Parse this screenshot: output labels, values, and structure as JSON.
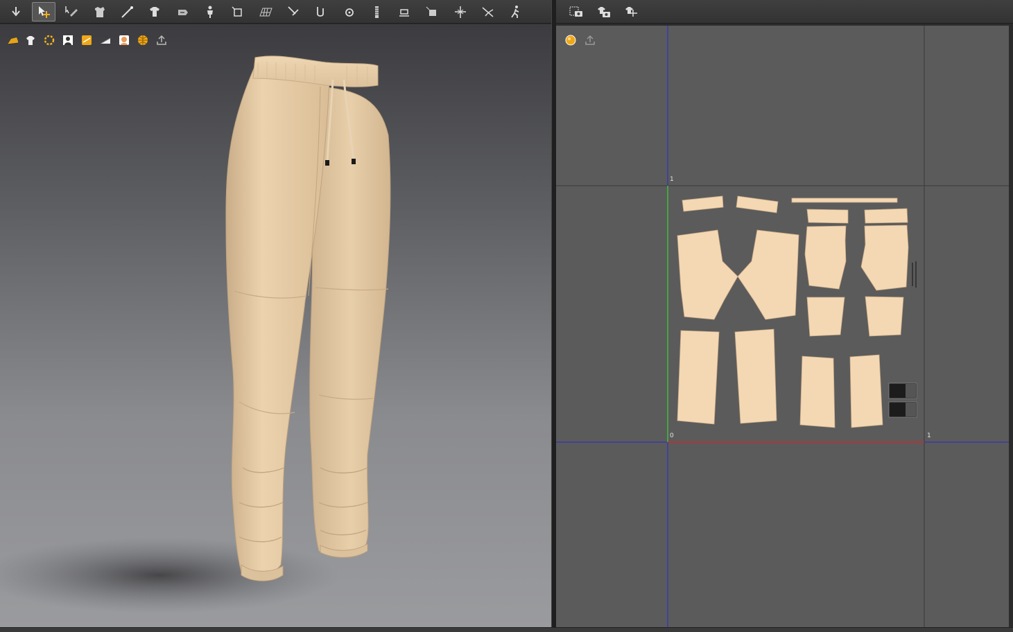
{
  "toolbar_3d": {
    "tools": [
      {
        "icon": "simulate-icon"
      },
      {
        "icon": "select-move-icon",
        "active": true
      },
      {
        "icon": "select-mesh-icon"
      },
      {
        "icon": "fold-arrangement-icon"
      },
      {
        "icon": "edit-curvature-icon"
      },
      {
        "icon": "garment-fit-icon"
      },
      {
        "icon": "tack-icon"
      },
      {
        "icon": "avatar-measure-icon"
      },
      {
        "icon": "transform-pattern-icon"
      },
      {
        "icon": "texture-mesh-icon"
      },
      {
        "icon": "pin-icon"
      },
      {
        "icon": "attach-icon"
      },
      {
        "icon": "button-icon"
      },
      {
        "icon": "zipper-icon"
      },
      {
        "icon": "measure-icon"
      },
      {
        "icon": "flatten-icon"
      },
      {
        "icon": "align-icon"
      },
      {
        "icon": "cut-icon"
      },
      {
        "icon": "walk-icon"
      }
    ]
  },
  "toolbar_2d": {
    "tools": [
      {
        "icon": "snapshot-2d-icon"
      },
      {
        "icon": "snapshot-3d-icon"
      },
      {
        "icon": "uv-arrange-icon"
      }
    ]
  },
  "viewport_3d": {
    "display_icons": [
      {
        "icon": "avatar-display-icon"
      },
      {
        "icon": "garment-display-icon"
      },
      {
        "icon": "hardware-display-icon"
      },
      {
        "icon": "avatar-silhouette-icon"
      },
      {
        "icon": "texture-display-icon"
      },
      {
        "icon": "lighting-icon"
      },
      {
        "icon": "skin-display-icon"
      },
      {
        "icon": "environment-icon"
      },
      {
        "icon": "export-icon"
      }
    ],
    "garment_color": "#e6cda8",
    "background_top": "#3c3c40",
    "background_bottom": "#9a9b9e"
  },
  "viewport_2d": {
    "display_icons": [
      {
        "icon": "render-sphere-icon"
      },
      {
        "icon": "export-uv-icon"
      }
    ],
    "axis_labels": {
      "origin": "0",
      "u_max": "1",
      "v_max": "1"
    },
    "pattern_color": "#f4d8b4",
    "u_axis_color": "#d0282c",
    "v_axis_color": "#3fbf3f",
    "grid_color": "#2a2ad0"
  }
}
